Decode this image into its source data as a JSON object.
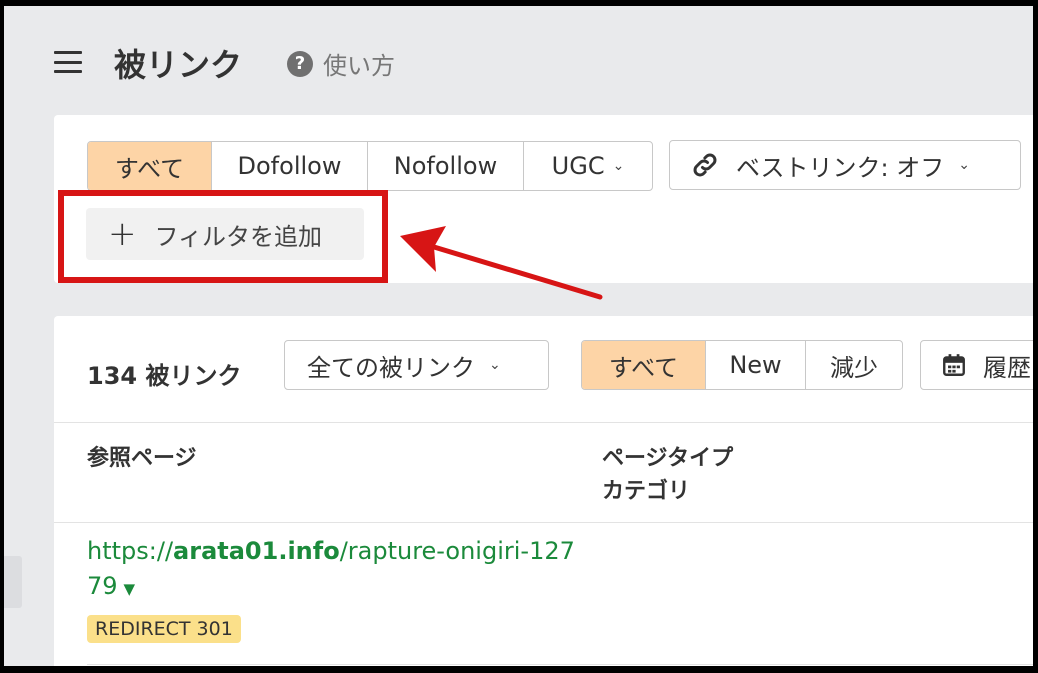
{
  "header": {
    "title": "被リンク",
    "help_label": "使い方",
    "help_icon": "?"
  },
  "filters": {
    "link_types": [
      {
        "label": "すべて",
        "active": true
      },
      {
        "label": "Dofollow",
        "active": false
      },
      {
        "label": "Nofollow",
        "active": false
      },
      {
        "label": "UGC",
        "active": false
      }
    ],
    "ugc_chevron": "⌄",
    "best_link_label": "ベストリンク: オフ",
    "add_filter_label": "フィルタを追加",
    "add_filter_icon": "+"
  },
  "backlinks": {
    "count_label": "134 被リンク",
    "scope_dropdown": "全ての被リンク",
    "change_filters": [
      {
        "label": "すべて",
        "active": true
      },
      {
        "label": "New",
        "active": false
      },
      {
        "label": "減少",
        "active": false
      }
    ],
    "history_label": "履歴",
    "columns": {
      "referring_page": "参照ページ",
      "page_type_line1": "ページタイプ",
      "page_type_line2": "カテゴリ"
    },
    "rows": [
      {
        "url_prefix": "https://",
        "url_domain": "arata01.info",
        "url_path": "/rapture-onigiri-12779",
        "badge": "REDIRECT 301"
      }
    ]
  },
  "colors": {
    "active_segment": "#fdd4a6",
    "link_green": "#1b8a3b",
    "highlight_red": "#d71515",
    "badge_yellow": "#fbe08a"
  }
}
